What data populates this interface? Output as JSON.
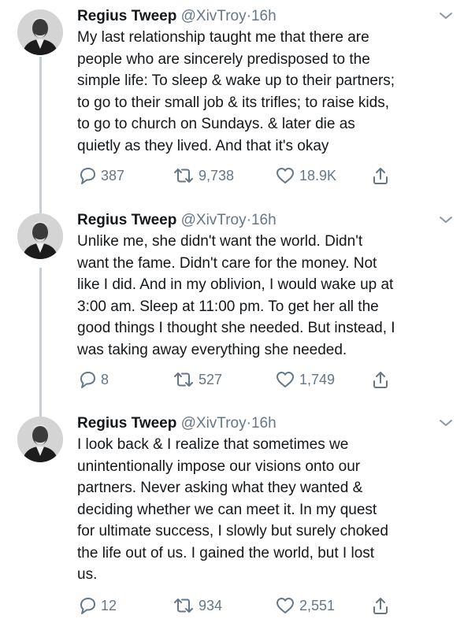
{
  "tweets": [
    {
      "name": "Regius Tweep",
      "handle": "@XivTroy",
      "separator": "·",
      "time": "16h",
      "lines": [
        "My last relationship taught me that there are",
        "people who are sincerely predisposed to the",
        "simple life: To sleep & wake up to their partners;",
        "to go to their small job & its trifles; to raise kids,",
        "to go to church on Sundays. & later die as",
        "quietly as they lived. And that it's okay"
      ],
      "replies": "387",
      "retweets": "9,738",
      "likes": "18.9K"
    },
    {
      "name": "Regius Tweep",
      "handle": "@XivTroy",
      "separator": "·",
      "time": "16h",
      "lines": [
        "Unlike me, she didn't want the world. Didn't",
        "want the fame. Didn't care for the money. Not",
        "like I did. And in my oblivion, I would wake up at",
        "3:00 am. Sleep at 11:00 pm. To get her all the",
        "good things I thought she needed. But instead, I",
        "was taking away everything she needed."
      ],
      "replies": "8",
      "retweets": "527",
      "likes": "1,749"
    },
    {
      "name": "Regius Tweep",
      "handle": "@XivTroy",
      "separator": "·",
      "time": "16h",
      "lines": [
        "I look back & I realize that sometimes we",
        "unintentionally impose our visions onto our",
        "partners. Never asking what they wanted &",
        "deciding whether we can meet it. In my quest",
        "for ultimate success, I slowly but surely choked",
        "the life out of us. I gained the world, but I lost",
        "us."
      ],
      "replies": "12",
      "retweets": "934",
      "likes": "2,551"
    }
  ],
  "icons": {
    "reply": "reply-icon",
    "retweet": "retweet-icon",
    "like": "heart-icon",
    "share": "share-icon",
    "menu": "chevron-down-icon"
  },
  "colors": {
    "text": "#14171a",
    "secondary": "#657786",
    "thread_line": "#c4cfd6"
  }
}
